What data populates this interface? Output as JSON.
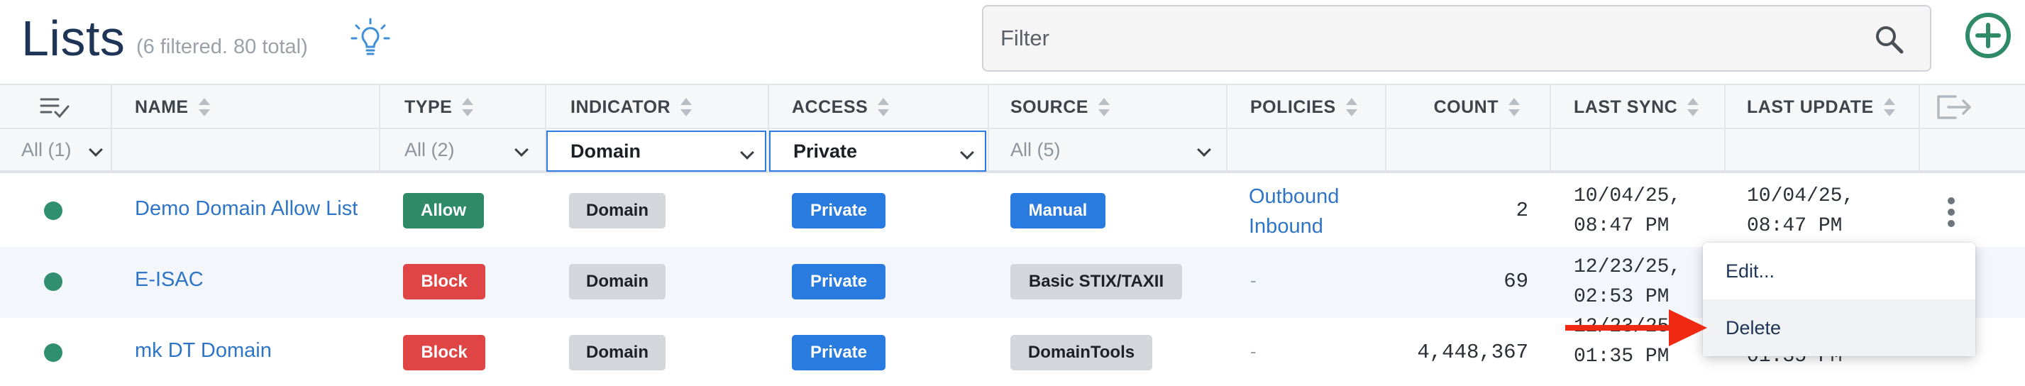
{
  "header": {
    "title": "Lists",
    "subtitle": "(6 filtered. 80 total)",
    "filter_placeholder": "Filter"
  },
  "columns": [
    {
      "label": "NAME"
    },
    {
      "label": "TYPE"
    },
    {
      "label": "INDICATOR"
    },
    {
      "label": "ACCESS"
    },
    {
      "label": "SOURCE"
    },
    {
      "label": "POLICIES"
    },
    {
      "label": "COUNT"
    },
    {
      "label": "LAST SYNC"
    },
    {
      "label": "LAST UPDATE"
    }
  ],
  "filters": {
    "status": "All (1)",
    "type": "All (2)",
    "indicator": "Domain",
    "access": "Private",
    "source": "All (5)"
  },
  "rows": [
    {
      "name": "Demo Domain Allow List",
      "type": "Allow",
      "indicator": "Domain",
      "access": "Private",
      "source": "Manual",
      "policy_1": "Outbound",
      "policy_2": "Inbound",
      "count": "2",
      "sync_1": "10/04/25,",
      "sync_2": "08:47 PM",
      "update_1": "10/04/25,",
      "update_2": "08:47 PM"
    },
    {
      "name": "E-ISAC",
      "type": "Block",
      "indicator": "Domain",
      "access": "Private",
      "source": "Basic STIX/TAXII",
      "policies": "-",
      "count": "69",
      "sync_1": "12/23/25,",
      "sync_2": "02:53 PM"
    },
    {
      "name": "mk DT Domain",
      "type": "Block",
      "indicator": "Domain",
      "access": "Private",
      "source": "DomainTools",
      "policies": "-",
      "count": "4,448,367",
      "sync_1": "12/23/25",
      "sync_2": "01:35 PM",
      "update_2": "01:35 PM"
    }
  ],
  "context_menu": {
    "edit": "Edit...",
    "delete": "Delete"
  },
  "colors": {
    "allow": "#2f8a68",
    "block": "#e04545",
    "link": "#2f75c7",
    "accent": "#2a7be0",
    "add": "#2f8a68",
    "arrow": "#f02a12"
  },
  "icons": {
    "bulb": "lightbulb-icon",
    "search": "search-icon",
    "add": "plus-circle-icon",
    "columns": "column-selector-icon",
    "export": "export-icon",
    "kebab": "kebab-menu-icon"
  }
}
